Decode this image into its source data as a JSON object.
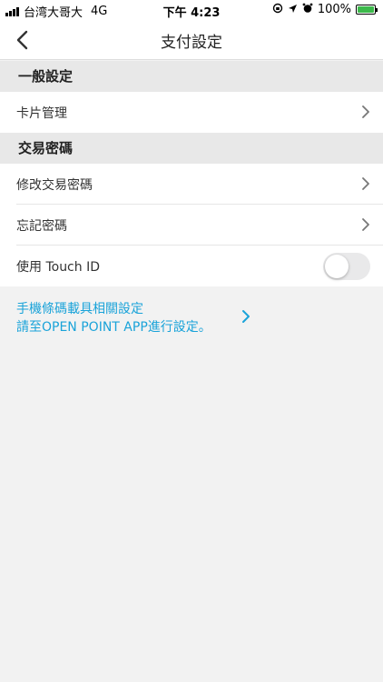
{
  "status_bar": {
    "carrier": "台湾大哥大",
    "network": "4G",
    "time": "下午 4:23",
    "battery": "100%",
    "battery_level": 1.0,
    "battery_color": "#3cb94b"
  },
  "nav": {
    "back_icon": "chevron-left-icon",
    "title": "支付設定"
  },
  "sections": {
    "general": {
      "title": "一般設定"
    },
    "password": {
      "title": "交易密碼"
    }
  },
  "rows": {
    "card_management": "卡片管理",
    "change_password": "修改交易密碼",
    "forgot_password": "忘記密碼",
    "touch_id": "使用 Touch ID"
  },
  "touch_id_enabled": false,
  "openpoint": {
    "line1": "手機條碼載具相關設定",
    "line2": "請至OPEN POINT APP進行設定。",
    "color": "#1aa3d9"
  }
}
